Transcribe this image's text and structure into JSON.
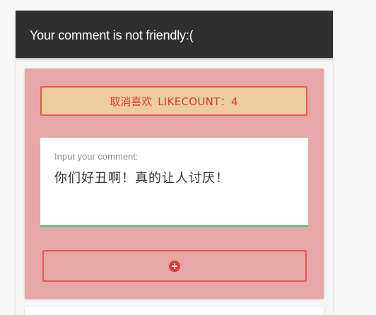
{
  "panel": {
    "title": "Your comment is not friendly:("
  },
  "card": {
    "like_button": {
      "label": "取消喜欢",
      "count_text": "LIKECOUNT：4",
      "count": 4
    },
    "comment": {
      "placeholder": "Input your comment:",
      "value": "你们好丑啊！真的让人讨厌！"
    },
    "add_button": {
      "icon": "plus-circle-icon"
    }
  },
  "colors": {
    "header_bg": "#2f2f2f",
    "card_bg": "#e6a7a6",
    "accent_red": "#e53935",
    "like_bg": "#ebcd9f",
    "input_underline": "#2ecc71"
  }
}
